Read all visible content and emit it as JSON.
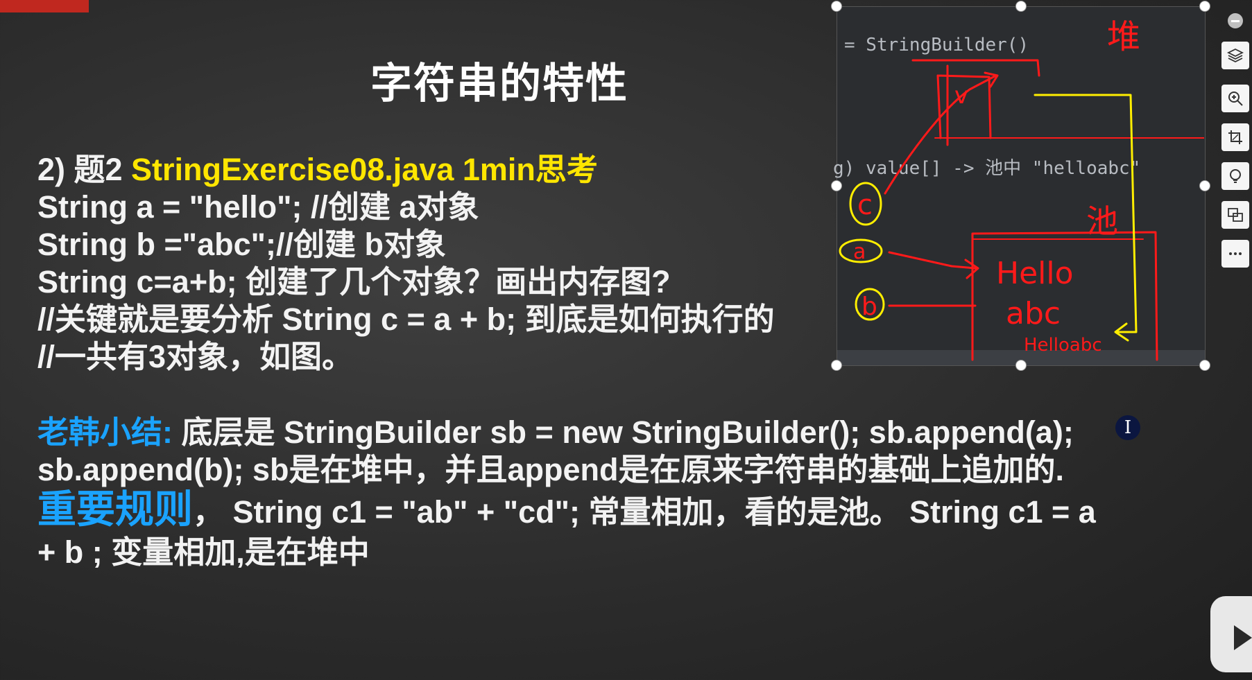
{
  "title": "字符串的特性",
  "question": {
    "prefix": "2) 题2 ",
    "highlight": "StringExercise08.java 1min思考",
    "lines": [
      "String a = \"hello\"; //创建 a对象",
      "String b =\"abc\";//创建 b对象",
      "String c=a+b; 创建了几个对象？画出内存图?",
      "//关键就是要分析 String c = a + b; 到底是如何执行的",
      "//一共有3对象，如图。"
    ]
  },
  "summary": {
    "label": "老韩小结:",
    "line1_rest": " 底层是 StringBuilder sb = new StringBuilder();  sb.append(a);",
    "line2": "sb.append(b); sb是在堆中，并且append是在原来字符串的基础上追加的."
  },
  "rules": {
    "label": "重要规则",
    "line1_rest": "，  String c1 = \"ab\" + \"cd\"; 常量相加，看的是池。  String c1 = a",
    "line2": "+ b ; 变量相加,是在堆中"
  },
  "snapshot": {
    "code_line1": "= StringBuilder()",
    "code_line2": "g) value[] -> 池中 \"helloabc\"",
    "ink_heap": "堆",
    "ink_pool": "池",
    "ink_c": "c",
    "ink_a": "a",
    "ink_b": "b",
    "ink_v": "v",
    "ink_hello": "Hello",
    "ink_abc": "abc",
    "ink_helloabc": "Helloabc"
  },
  "colors": {
    "ink_red": "#ff1a1a",
    "ink_yellow": "#ffee00",
    "question_highlight": "#ffe600",
    "summary_label": "#1aa3ff"
  },
  "toolbar": {
    "icons": [
      "minus-circle-icon",
      "layers-icon",
      "zoom-in-icon",
      "crop-icon",
      "lightbulb-icon",
      "translate-icon",
      "more-icon"
    ]
  },
  "cursor": {
    "glyph": "I"
  }
}
